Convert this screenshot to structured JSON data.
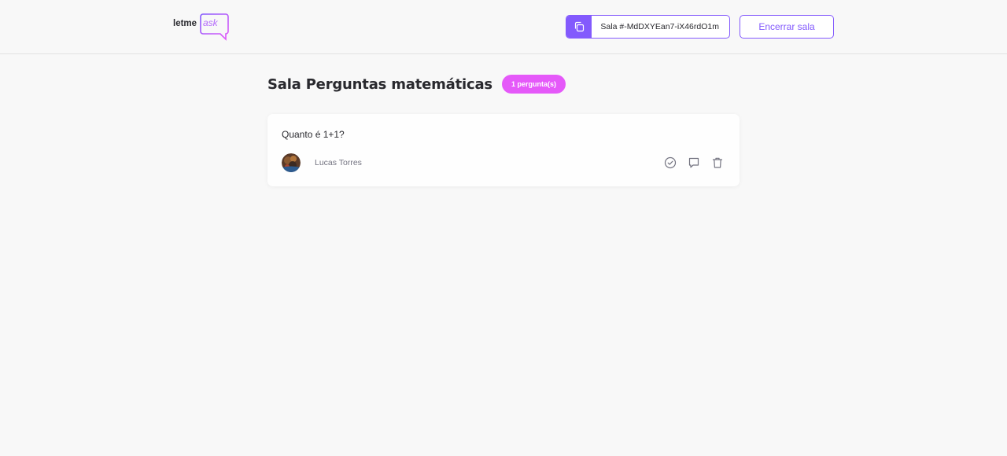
{
  "header": {
    "logo": {
      "text_main": "letme",
      "text_accent": "ask"
    },
    "room_code": {
      "label": "Sala #-MdDXYEan7-iX46rdO1m",
      "icon": "copy-icon"
    },
    "end_room_label": "Encerrar sala"
  },
  "room": {
    "title": "Sala Perguntas matemáticas",
    "question_count_badge": "1 pergunta(s)"
  },
  "questions": [
    {
      "content": "Quanto é 1+1?",
      "author": "Lucas Torres",
      "actions": [
        "check-icon",
        "answer-icon",
        "trash-icon"
      ]
    }
  ],
  "colors": {
    "purple": "#835afd",
    "pink": "#e559f9",
    "background": "#f8f8f8",
    "text": "#29292e",
    "muted": "#737380"
  }
}
